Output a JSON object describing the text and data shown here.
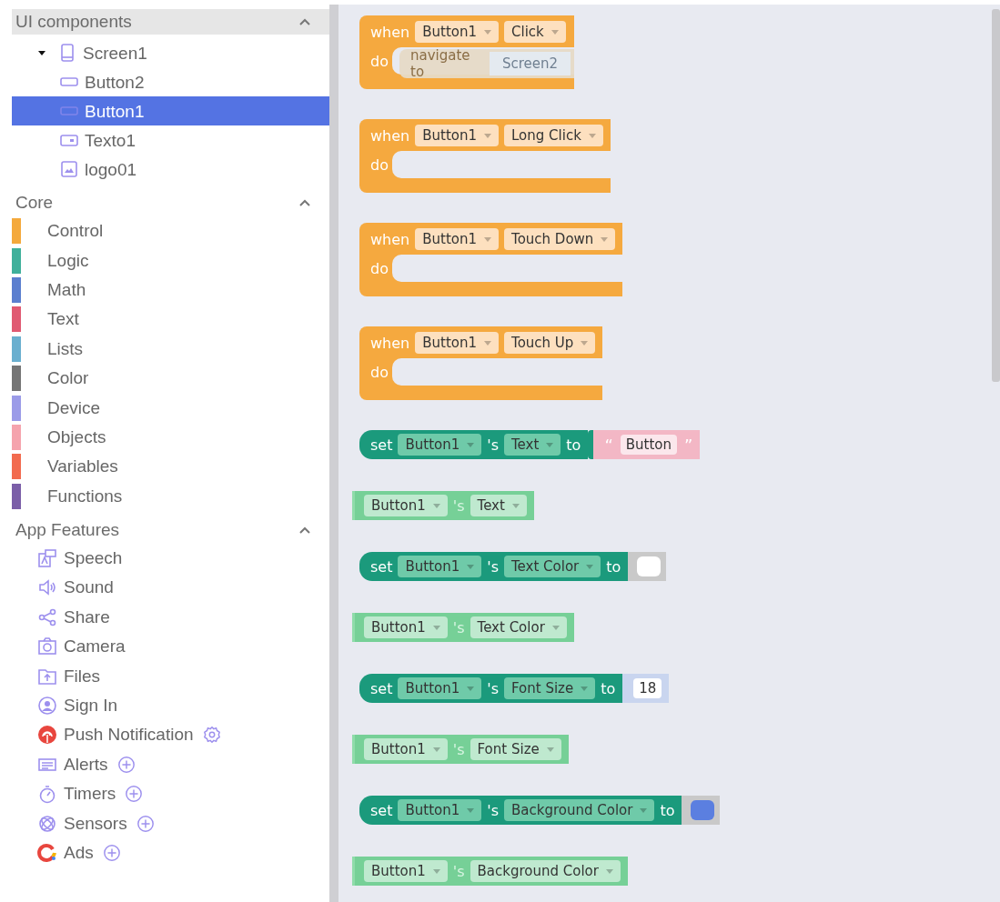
{
  "sidebar": {
    "sections": [
      {
        "title": "UI components",
        "expanded": true,
        "kind": "tree",
        "items": [
          {
            "label": "Screen1",
            "kind": "screen",
            "expanded": true,
            "selected": false,
            "children": [
              {
                "label": "Button2",
                "kind": "button",
                "selected": false
              },
              {
                "label": "Button1",
                "kind": "button",
                "selected": true
              },
              {
                "label": "Texto1",
                "kind": "textbox",
                "selected": false
              },
              {
                "label": "logo01",
                "kind": "image",
                "selected": false
              }
            ]
          }
        ]
      },
      {
        "title": "Core",
        "expanded": true,
        "kind": "categories",
        "items": [
          {
            "label": "Control",
            "color": "#f4a93c"
          },
          {
            "label": "Logic",
            "color": "#3fb09b"
          },
          {
            "label": "Math",
            "color": "#5b7fcf"
          },
          {
            "label": "Text",
            "color": "#e05a72"
          },
          {
            "label": "Lists",
            "color": "#6aafcf"
          },
          {
            "label": "Color",
            "color": "#757575"
          },
          {
            "label": "Device",
            "color": "#9b9be8"
          },
          {
            "label": "Objects",
            "color": "#f5a3ad"
          },
          {
            "label": "Variables",
            "color": "#f26b4f"
          },
          {
            "label": "Functions",
            "color": "#7b5ea8"
          }
        ]
      },
      {
        "title": "App Features",
        "expanded": true,
        "kind": "features",
        "items": [
          {
            "label": "Speech",
            "kind": "speech",
            "configurable": false,
            "addable": false
          },
          {
            "label": "Sound",
            "kind": "sound",
            "configurable": false,
            "addable": false
          },
          {
            "label": "Share",
            "kind": "share",
            "configurable": false,
            "addable": false
          },
          {
            "label": "Camera",
            "kind": "camera",
            "configurable": false,
            "addable": false
          },
          {
            "label": "Files",
            "kind": "files",
            "configurable": false,
            "addable": false
          },
          {
            "label": "Sign In",
            "kind": "signin",
            "configurable": false,
            "addable": false
          },
          {
            "label": "Push Notification",
            "kind": "push",
            "configurable": true,
            "addable": false
          },
          {
            "label": "Alerts",
            "kind": "alerts",
            "configurable": false,
            "addable": true
          },
          {
            "label": "Timers",
            "kind": "timers",
            "configurable": false,
            "addable": true
          },
          {
            "label": "Sensors",
            "kind": "sensors",
            "configurable": false,
            "addable": true
          },
          {
            "label": "Ads",
            "kind": "ads",
            "configurable": false,
            "addable": true
          }
        ]
      }
    ]
  },
  "blocks": [
    {
      "kind": "event",
      "when": "when",
      "component": "Button1",
      "event": "Click",
      "do": "do",
      "ghost": {
        "label": "navigate to",
        "value": "Screen2"
      }
    },
    {
      "kind": "event",
      "when": "when",
      "component": "Button1",
      "event": "Long Click",
      "do": "do"
    },
    {
      "kind": "event",
      "when": "when",
      "component": "Button1",
      "event": "Touch Down",
      "do": "do"
    },
    {
      "kind": "event",
      "when": "when",
      "component": "Button1",
      "event": "Touch Up",
      "do": "do"
    },
    {
      "kind": "setter",
      "set": "set",
      "component": "Button1",
      "possessive": "'s",
      "property": "Text",
      "to": "to",
      "value": {
        "kind": "text",
        "open_quote": "“",
        "text": "Button",
        "close_quote": "”"
      }
    },
    {
      "kind": "getter",
      "component": "Button1",
      "possessive": "'s",
      "property": "Text"
    },
    {
      "kind": "setter",
      "set": "set",
      "component": "Button1",
      "possessive": "'s",
      "property": "Text Color",
      "to": "to",
      "value": {
        "kind": "color",
        "color": "#ffffff"
      }
    },
    {
      "kind": "getter",
      "component": "Button1",
      "possessive": "'s",
      "property": "Text Color"
    },
    {
      "kind": "setter",
      "set": "set",
      "component": "Button1",
      "possessive": "'s",
      "property": "Font Size",
      "to": "to",
      "value": {
        "kind": "number",
        "text": "18"
      }
    },
    {
      "kind": "getter",
      "component": "Button1",
      "possessive": "'s",
      "property": "Font Size"
    },
    {
      "kind": "setter",
      "set": "set",
      "component": "Button1",
      "possessive": "'s",
      "property": "Background Color",
      "to": "to",
      "value": {
        "kind": "color",
        "color": "#5b7fe0"
      }
    },
    {
      "kind": "getter",
      "component": "Button1",
      "possessive": "'s",
      "property": "Background Color"
    }
  ]
}
